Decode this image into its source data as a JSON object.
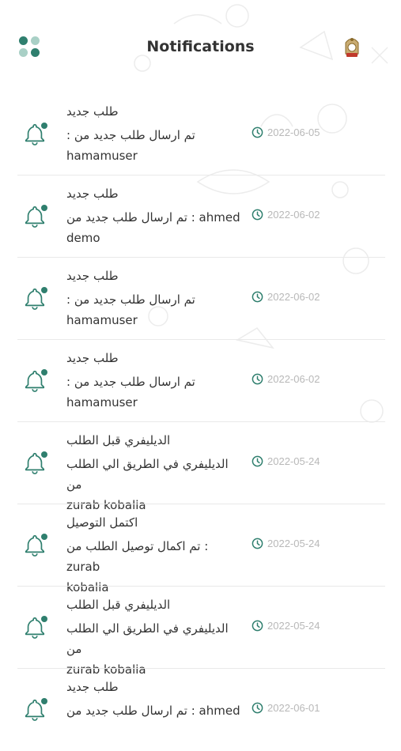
{
  "header": {
    "title": "Notifications",
    "menu_icon": "grid-dots-icon",
    "avatar": "restaurant-logo"
  },
  "colors": {
    "accent": "#2f7f6e",
    "accent_light": "#a9d0c6",
    "date_text": "#b8b8b8",
    "separator": "#e9e9e9"
  },
  "notifications": [
    {
      "title": "طلب جديد",
      "message_line1": ": تم ارسال طلب جديد من",
      "message_line2": "hamamuser",
      "date": "2022-06-05"
    },
    {
      "title": "طلب جديد",
      "message_line1": "تم ارسال طلب جديد من : ahmed",
      "message_line2": "demo",
      "date": "2022-06-02"
    },
    {
      "title": "طلب جديد",
      "message_line1": ": تم ارسال طلب جديد من",
      "message_line2": "hamamuser",
      "date": "2022-06-02"
    },
    {
      "title": "طلب جديد",
      "message_line1": ": تم ارسال طلب جديد من",
      "message_line2": "hamamuser",
      "date": "2022-06-02"
    },
    {
      "title": "الديليفري قبل الطلب",
      "message_line1": "الديليفري في الطريق الي الطلب من",
      "message_line2": "zurab kobalia",
      "date": "2022-05-24"
    },
    {
      "title": "اكتمل التوصيل",
      "message_line1": "تم اكمال توصيل الطلب من : zurab",
      "message_line2": "kobalia",
      "date": "2022-05-24"
    },
    {
      "title": "الديليفري قبل الطلب",
      "message_line1": "الديليفري في الطريق الي الطلب من",
      "message_line2": "zurab kobalia",
      "date": "2022-05-24"
    },
    {
      "title": "طلب جديد",
      "message_line1": "تم ارسال طلب جديد من : ahmed",
      "message_line2": "",
      "date": "2022-06-01"
    }
  ]
}
